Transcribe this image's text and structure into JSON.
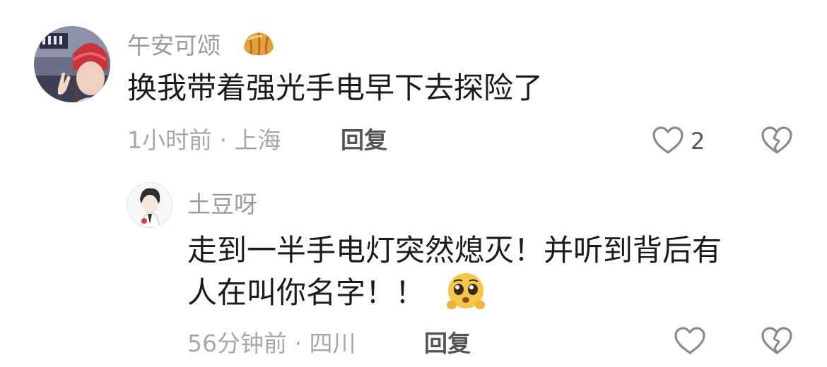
{
  "comments": [
    {
      "username": "午安可颂",
      "username_emoji": "croissant-icon",
      "text": "换我带着强光手电早下去探险了",
      "time": "1小时前",
      "location": "上海",
      "separator": " · ",
      "reply_label": "回复",
      "like_count": "2",
      "icons": {
        "like": "heart-outline-icon",
        "dislike": "broken-heart-icon"
      }
    },
    {
      "username": "土豆呀",
      "text_line1": "走到一半手电灯突然熄灭！并听到背后有",
      "text_line2": "人在叫你名字！！",
      "text_emoji": "pleading-face-icon",
      "time": "56分钟前",
      "location": "四川",
      "separator": " · ",
      "reply_label": "回复",
      "icons": {
        "like": "heart-outline-icon",
        "dislike": "broken-heart-icon"
      }
    }
  ],
  "colors": {
    "username": "#9a9a9a",
    "content": "#1b1b1b",
    "meta": "#a8a8a8",
    "icon_stroke": "#8a8a8a"
  }
}
